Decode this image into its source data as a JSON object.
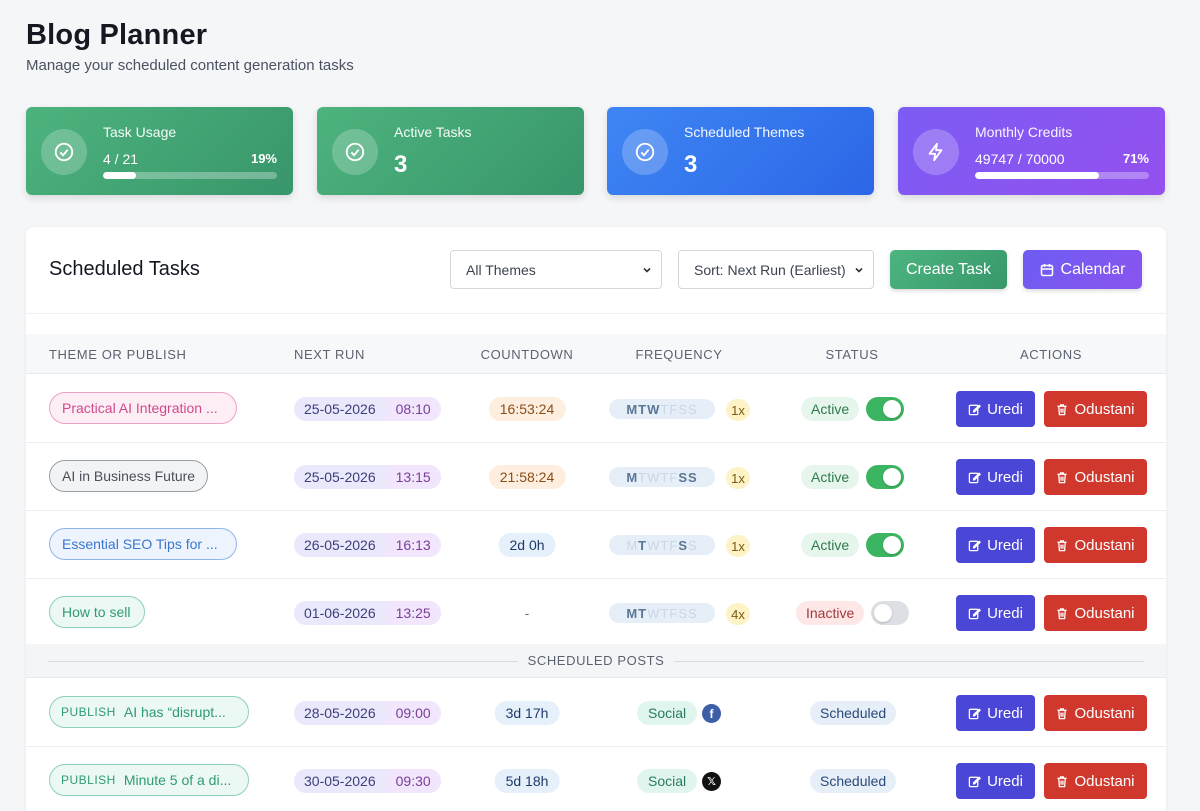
{
  "header": {
    "title": "Blog Planner",
    "subtitle": "Manage your scheduled content generation tasks"
  },
  "stats": {
    "task_usage": {
      "label": "Task Usage",
      "value": "4 / 21",
      "percent_label": "19%",
      "fill": 0.19,
      "icon": "check-circle-icon"
    },
    "active_tasks": {
      "label": "Active Tasks",
      "value": "3",
      "icon": "check-circle-icon"
    },
    "scheduled_themes": {
      "label": "Scheduled Themes",
      "value": "3",
      "icon": "check-circle-icon"
    },
    "monthly_credits": {
      "label": "Monthly Credits",
      "value": "49747 / 70000",
      "percent_label": "71%",
      "fill": 0.71,
      "icon": "lightning-icon"
    }
  },
  "panel": {
    "title": "Scheduled Tasks",
    "theme_filter": "All Themes",
    "sort": "Sort: Next Run (Earliest)",
    "create_label": "Create Task",
    "calendar_label": "Calendar"
  },
  "columns": [
    "THEME OR PUBLISH",
    "NEXT RUN",
    "COUNTDOWN",
    "FREQUENCY",
    "STATUS",
    "ACTIONS"
  ],
  "actions": {
    "edit": "Uredi",
    "cancel": "Odustani"
  },
  "tasks": [
    {
      "theme": "Practical AI Integration ...",
      "date": "25-05-2026",
      "time": "08:10",
      "countdown": "16:53:24",
      "days": "MTWTFSS",
      "active_days": [
        true,
        true,
        true,
        false,
        false,
        false,
        false
      ],
      "times": "1x",
      "status": "Active",
      "enabled": true
    },
    {
      "theme": "AI in Business Future",
      "date": "25-05-2026",
      "time": "13:15",
      "countdown": "21:58:24",
      "days": "MTWTFSS",
      "active_days": [
        true,
        false,
        false,
        false,
        false,
        true,
        true
      ],
      "times": "1x",
      "status": "Active",
      "enabled": true
    },
    {
      "theme": "Essential SEO Tips for ...",
      "date": "26-05-2026",
      "time": "16:13",
      "countdown": "2d 0h",
      "days": "MTWTFSS",
      "active_days": [
        false,
        true,
        false,
        false,
        false,
        true,
        false
      ],
      "times": "1x",
      "status": "Active",
      "enabled": true
    },
    {
      "theme": "How to sell",
      "date": "01-06-2026",
      "time": "13:25",
      "countdown": "-",
      "days": "MTWTFSS",
      "active_days": [
        true,
        true,
        false,
        false,
        false,
        false,
        false
      ],
      "times": "4x",
      "status": "Inactive",
      "enabled": false
    }
  ],
  "posts_section_label": "SCHEDULED POSTS",
  "posts": [
    {
      "tag": "PUBLISH",
      "title": "AI has “disrupt...",
      "date": "28-05-2026",
      "time": "09:00",
      "countdown": "3d 17h",
      "channel": "Social",
      "network": "facebook",
      "network_glyph": "f",
      "status": "Scheduled"
    },
    {
      "tag": "PUBLISH",
      "title": "Minute 5 of a di...",
      "date": "30-05-2026",
      "time": "09:30",
      "countdown": "5d 18h",
      "channel": "Social",
      "network": "x",
      "network_glyph": "𝕏",
      "status": "Scheduled"
    }
  ]
}
